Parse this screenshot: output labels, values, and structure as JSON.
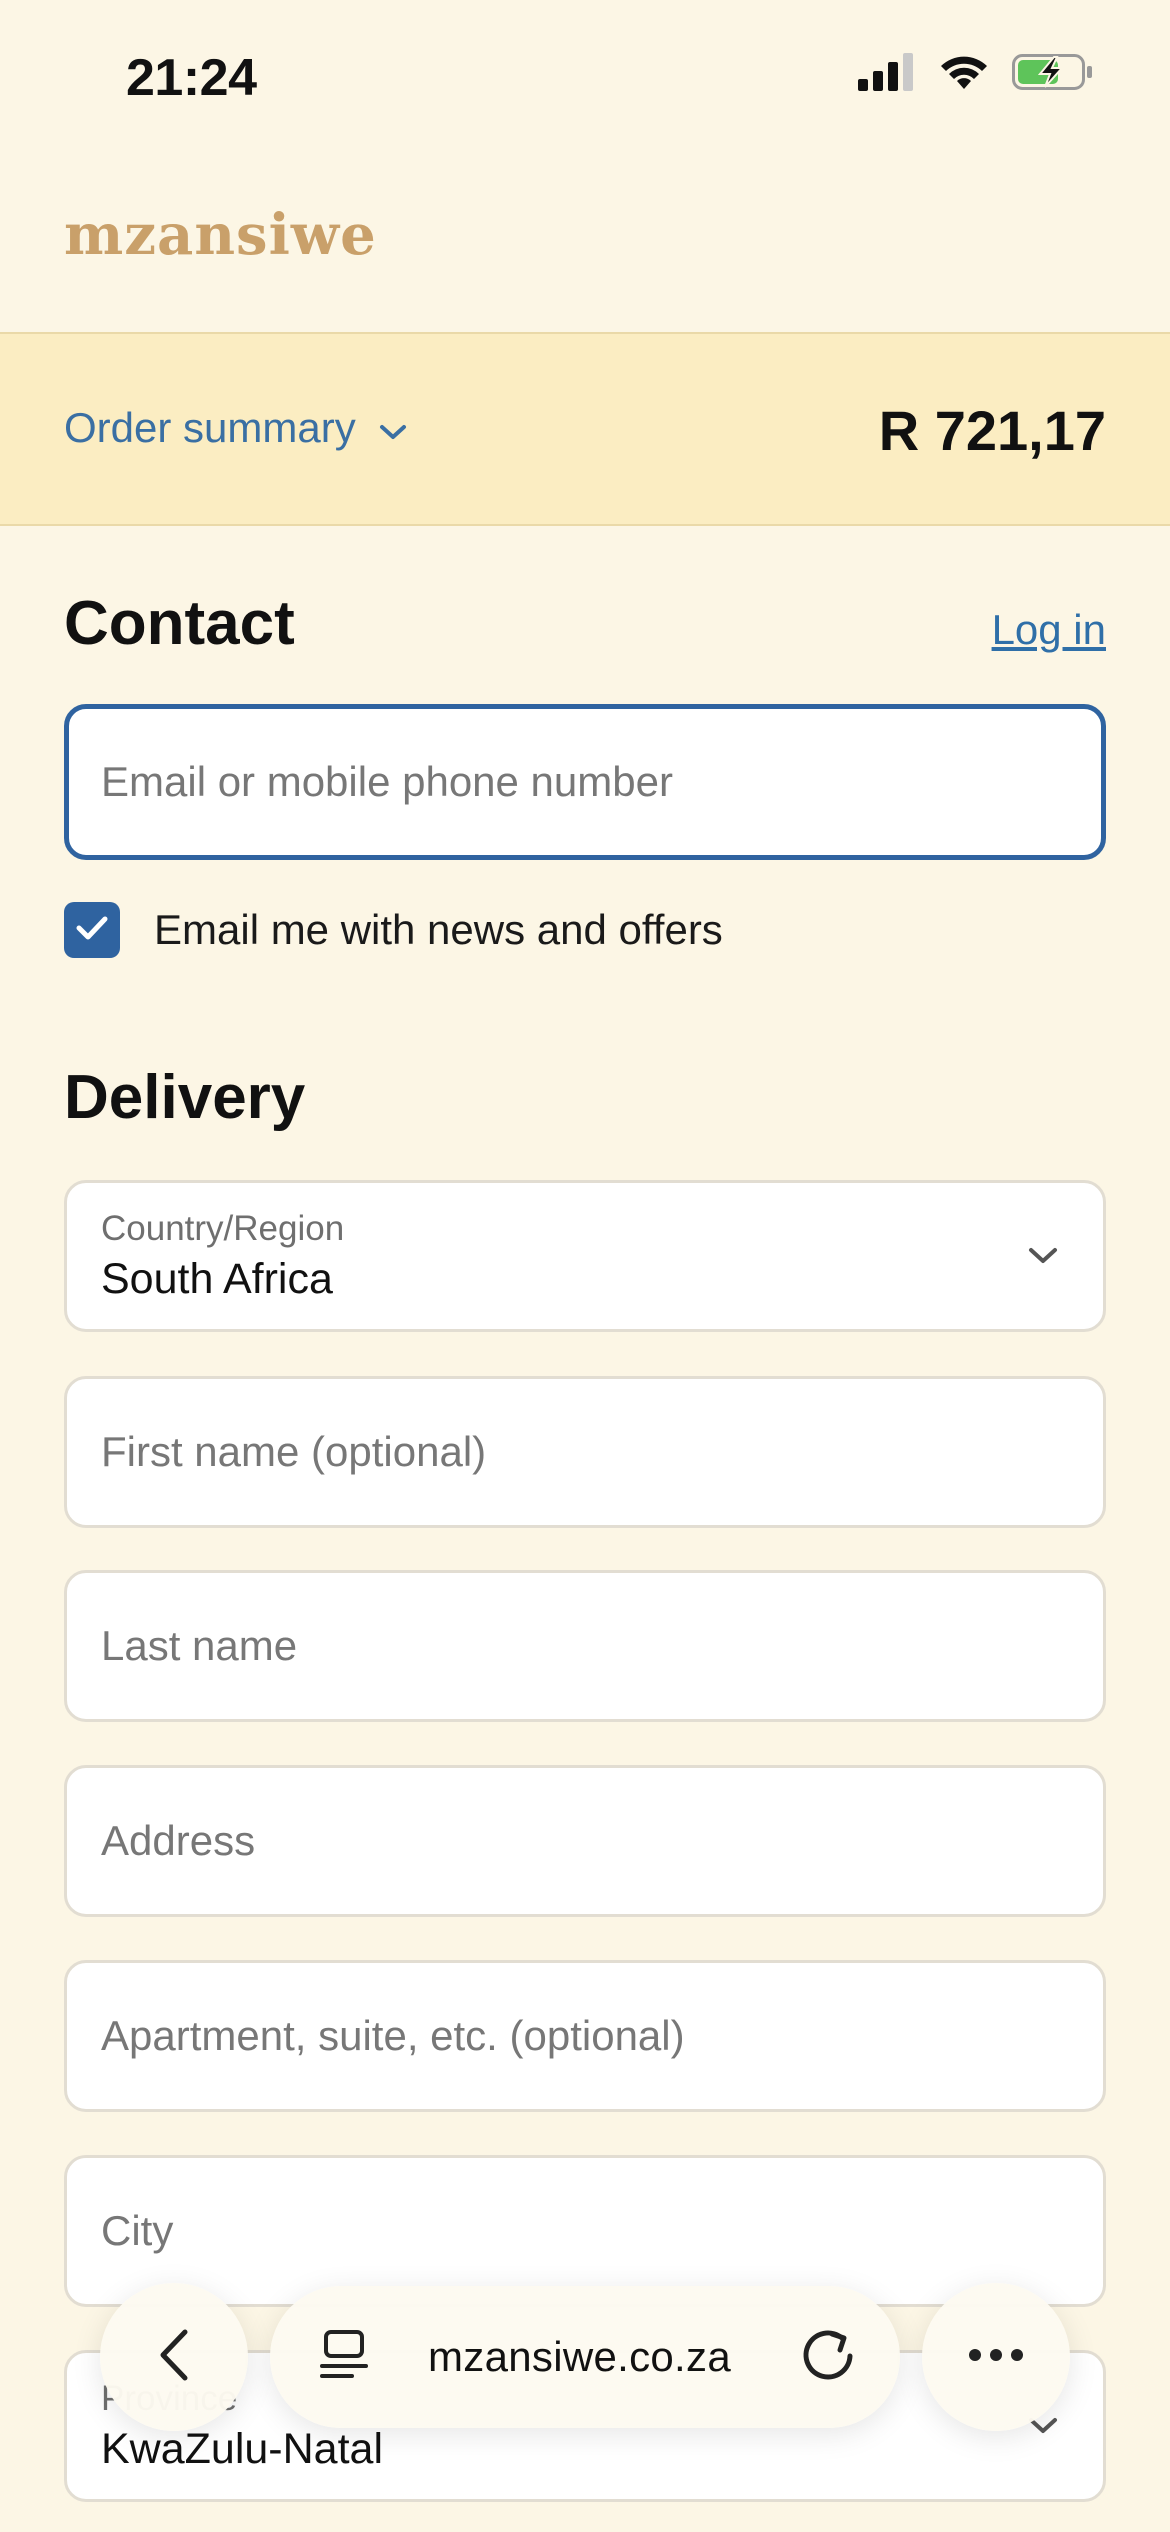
{
  "status_bar": {
    "time": "21:24"
  },
  "brand": {
    "name": "mzansiwe"
  },
  "order_summary": {
    "label": "Order summary",
    "total": "R 721,17"
  },
  "contact": {
    "heading": "Contact",
    "login_link": "Log in",
    "email_placeholder": "Email or mobile phone number",
    "newsletter_label": "Email me with news and offers",
    "newsletter_checked": true
  },
  "delivery": {
    "heading": "Delivery",
    "country_label": "Country/Region",
    "country_value": "South Africa",
    "first_name_placeholder": "First name (optional)",
    "last_name_placeholder": "Last name",
    "address_placeholder": "Address",
    "apartment_placeholder": "Apartment, suite, etc. (optional)",
    "city_placeholder": "City",
    "province_label": "Province",
    "province_value": "KwaZulu-Natal"
  },
  "browser": {
    "url": "mzansiwe.co.za"
  },
  "colors": {
    "accent": "#2f63a0",
    "link": "#3a6fa3",
    "brand": "#c9a06a",
    "background": "#fcf6e5",
    "summary_bg": "#fbedc2"
  }
}
